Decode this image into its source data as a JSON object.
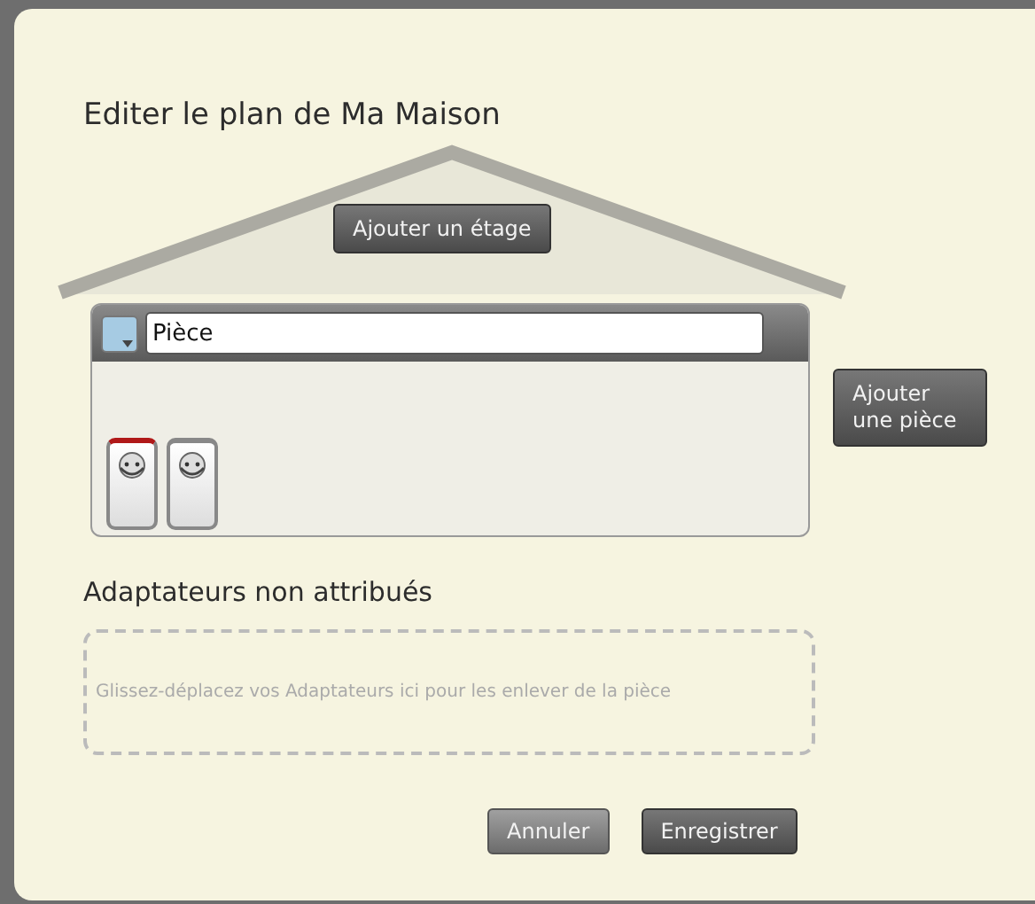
{
  "dialog": {
    "title": "Editer le plan de Ma Maison",
    "add_floor_button": "Ajouter un étage",
    "room": {
      "name": "Pièce",
      "color": "#a6cbe3",
      "adapters": [
        {
          "selected": true
        },
        {
          "selected": false
        }
      ]
    },
    "add_room_button": "Ajouter une pièce",
    "unassigned": {
      "title": "Adaptateurs non attribués",
      "hint": "Glissez-déplacez vos Adaptateurs ici pour les enlever de la pièce"
    },
    "buttons": [
      {
        "label": "Annuler",
        "kind": "secondary"
      },
      {
        "label": "Enregistrer",
        "kind": "primary"
      }
    ]
  }
}
